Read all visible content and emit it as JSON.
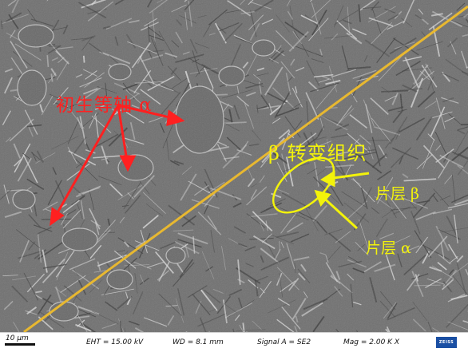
{
  "image": {
    "labels": {
      "primary_alpha": "初生等轴 α",
      "beta_transformed": "β 转变组织",
      "lamellar_beta": "片层 β",
      "lamellar_alpha": "片层 α"
    },
    "colors": {
      "red_annotation": "#ff2020",
      "yellow_annotation": "#f3f30a",
      "divider_line": "#e8b830"
    }
  },
  "info_bar": {
    "scale_text": "10 μm",
    "eht": "EHT = 15.00 kV",
    "wd": "WD =  8.1 mm",
    "signal": "Signal A = SE2",
    "mag": "Mag =   2.00 K X",
    "logo": "ZEISS"
  }
}
